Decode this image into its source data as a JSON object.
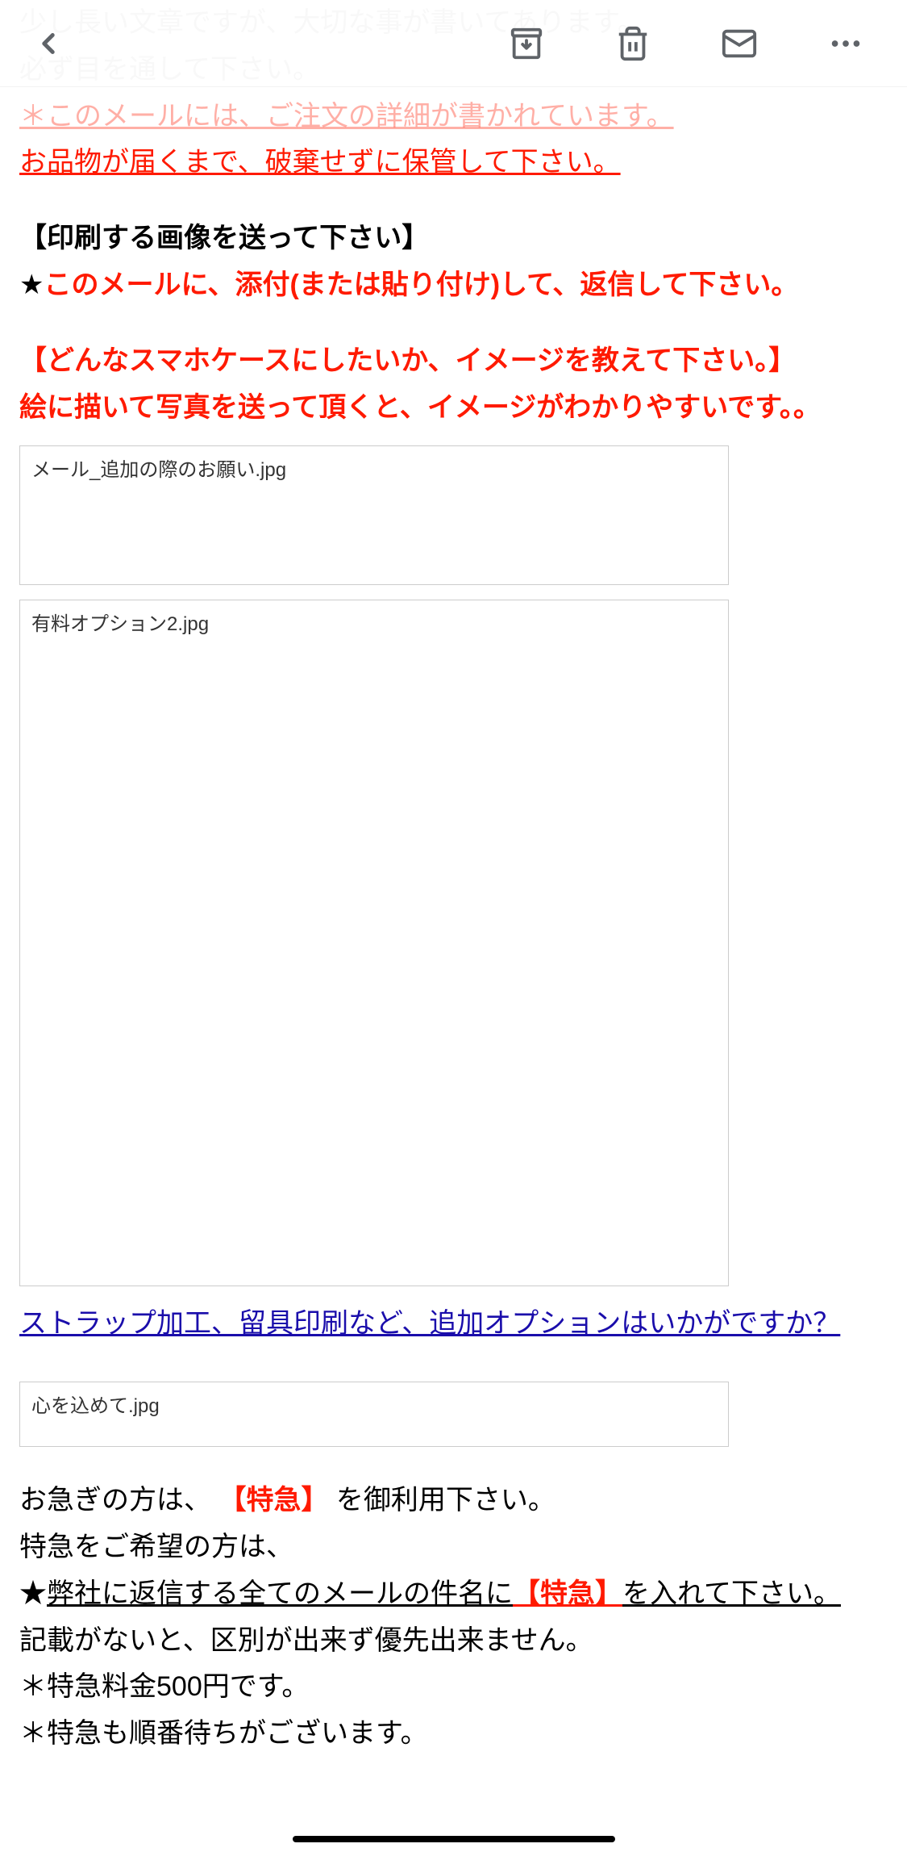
{
  "body": {
    "line1": "少し長い文章ですが、大切な事が書いてあります。",
    "line2": "必ず目を通して下さい。",
    "line3": "＊このメールには、ご注文の詳細が書かれています。",
    "line4": "お品物が届くまで、破棄せずに保管して下さい。",
    "section1_title": "【印刷する画像を送って下さい】",
    "section1_star": "★",
    "section1_text": "このメールに、添付(または貼り付け)して、返信して下さい。",
    "section2_title": "【どんなスマホケースにしたいか、イメージを教えて下さい。】",
    "section2_text": "絵に描いて写真を送って頂くと、イメージがわかりやすいです。。",
    "link1": "ストラップ加工、留具印刷など、追加オプションはいかがですか？",
    "express1a": "お急ぎの方は、",
    "express1b": "【特急】",
    "express1c": "を御利用下さい。",
    "express2": "特急をご希望の方は、",
    "express3a": "★",
    "express3b": "弊社に返信する全てのメールの件名に",
    "express3c": "【特急】",
    "express3d": "を入れて下さい。",
    "express4": "記載がないと、区別が出来ず優先出来ません。",
    "express5": "＊特急料金500円です。",
    "express6": "＊特急も順番待ちがございます。"
  },
  "attachments": {
    "a1": "メール_追加の際のお願い.jpg",
    "a2": "有料オプション2.jpg",
    "a3": "心を込めて.jpg"
  }
}
